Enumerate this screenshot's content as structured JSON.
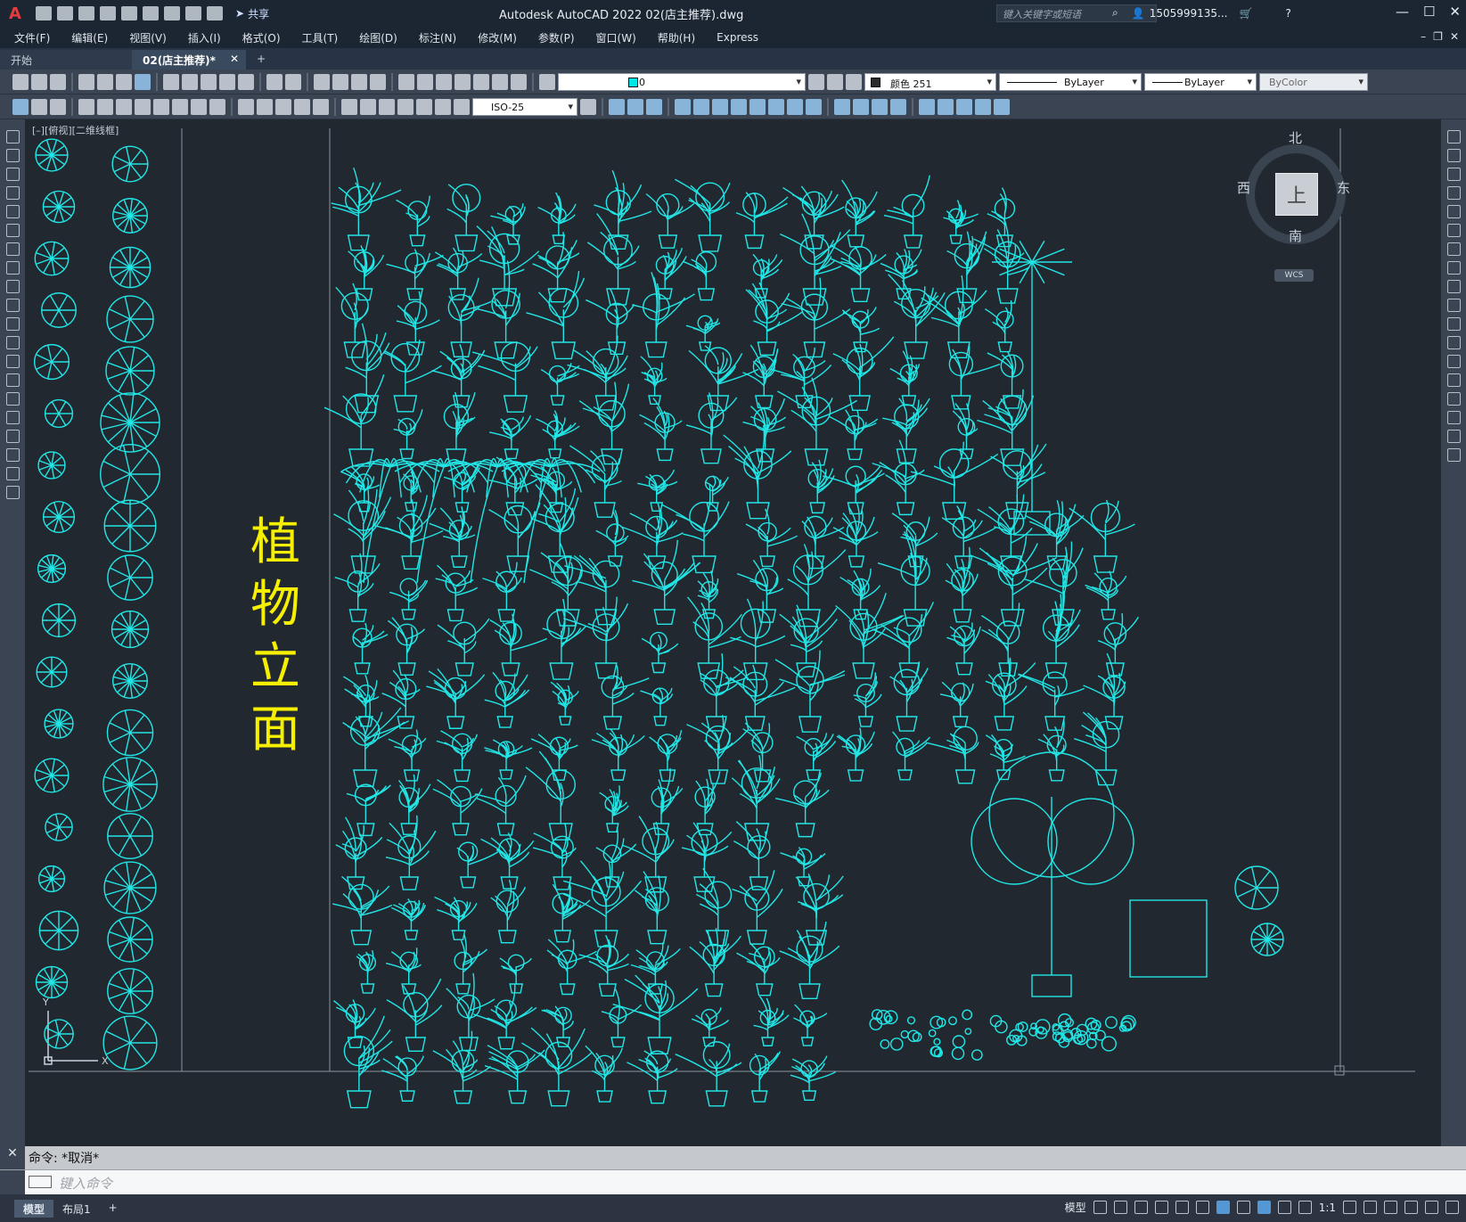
{
  "app": {
    "title": "Autodesk AutoCAD 2022    02(店主推荐).dwg",
    "share_label": "共享",
    "search_placeholder": "键入关键字或短语",
    "user": "1505999135..."
  },
  "menu": [
    "文件(F)",
    "编辑(E)",
    "视图(V)",
    "插入(I)",
    "格式(O)",
    "工具(T)",
    "绘图(D)",
    "标注(N)",
    "修改(M)",
    "参数(P)",
    "窗口(W)",
    "帮助(H)",
    "Express"
  ],
  "tabs": {
    "start": "开始",
    "active": "02(店主推荐)*",
    "close": "✕",
    "add": "+"
  },
  "properties": {
    "layer": "0",
    "color": "颜色 251",
    "linetype": "ByLayer",
    "lineweight": "ByLayer",
    "plotstyle": "ByColor",
    "dimstyle": "ISO-25"
  },
  "viewport": {
    "control": "[–][俯视][二维线框]"
  },
  "drawing": {
    "title": "植物立面",
    "colors": {
      "plant": "#22e6e6",
      "title": "#f6f000",
      "frame": "#8a93a0"
    }
  },
  "viewcube": {
    "north": "北",
    "south": "南",
    "east": "东",
    "west": "西",
    "face": "上",
    "wcs": "WCS"
  },
  "command": {
    "history": "命令:  *取消*",
    "placeholder": "键入命令"
  },
  "status": {
    "model_tab": "模型",
    "layout_tab": "布局1",
    "add": "+",
    "model_button": "模型",
    "scale": "1:1"
  }
}
